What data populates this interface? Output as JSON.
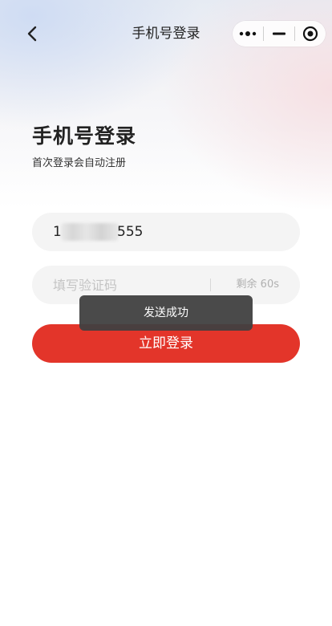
{
  "nav": {
    "title": "手机号登录",
    "back_icon": "chevron-left-icon",
    "capsule": {
      "more_icon": "more-dots-icon",
      "minimize_icon": "minimize-icon",
      "close_icon": "target-circle-icon"
    }
  },
  "header": {
    "title": "手机号登录",
    "subtitle": "首次登录会自动注册"
  },
  "form": {
    "phone": {
      "prefix": "1",
      "suffix": "555"
    },
    "code": {
      "placeholder": "填写验证码",
      "value": ""
    },
    "countdown": "剩余 60s"
  },
  "login_button": "立即登录",
  "toast": "发送成功",
  "colors": {
    "primary": "#e3352a",
    "toast_bg": "#404040",
    "field_bg": "#f4f4f4"
  }
}
